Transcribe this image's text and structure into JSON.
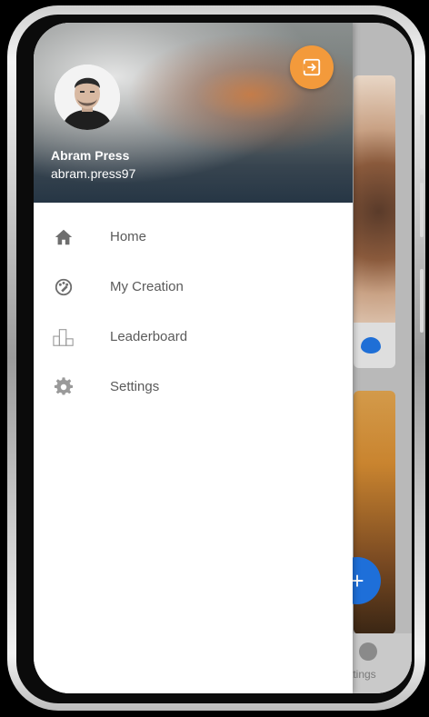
{
  "drawer": {
    "user": {
      "name": "Abram Press",
      "handle": "abram.press97"
    },
    "logout_icon": "logout-icon",
    "menu": [
      {
        "label": "Home",
        "icon": "home-icon"
      },
      {
        "label": "My Creation",
        "icon": "palette-icon"
      },
      {
        "label": "Leaderboard",
        "icon": "leaderboard-icon"
      },
      {
        "label": "Settings",
        "icon": "gear-icon"
      }
    ]
  },
  "background_app": {
    "nav_label": "ttings",
    "fab_symbol": "+"
  },
  "colors": {
    "accent_orange": "#f39a3b",
    "fab_blue": "#1e6fd9",
    "menu_text": "#5a5a5a",
    "icon_gray": "#6e6e6e"
  }
}
